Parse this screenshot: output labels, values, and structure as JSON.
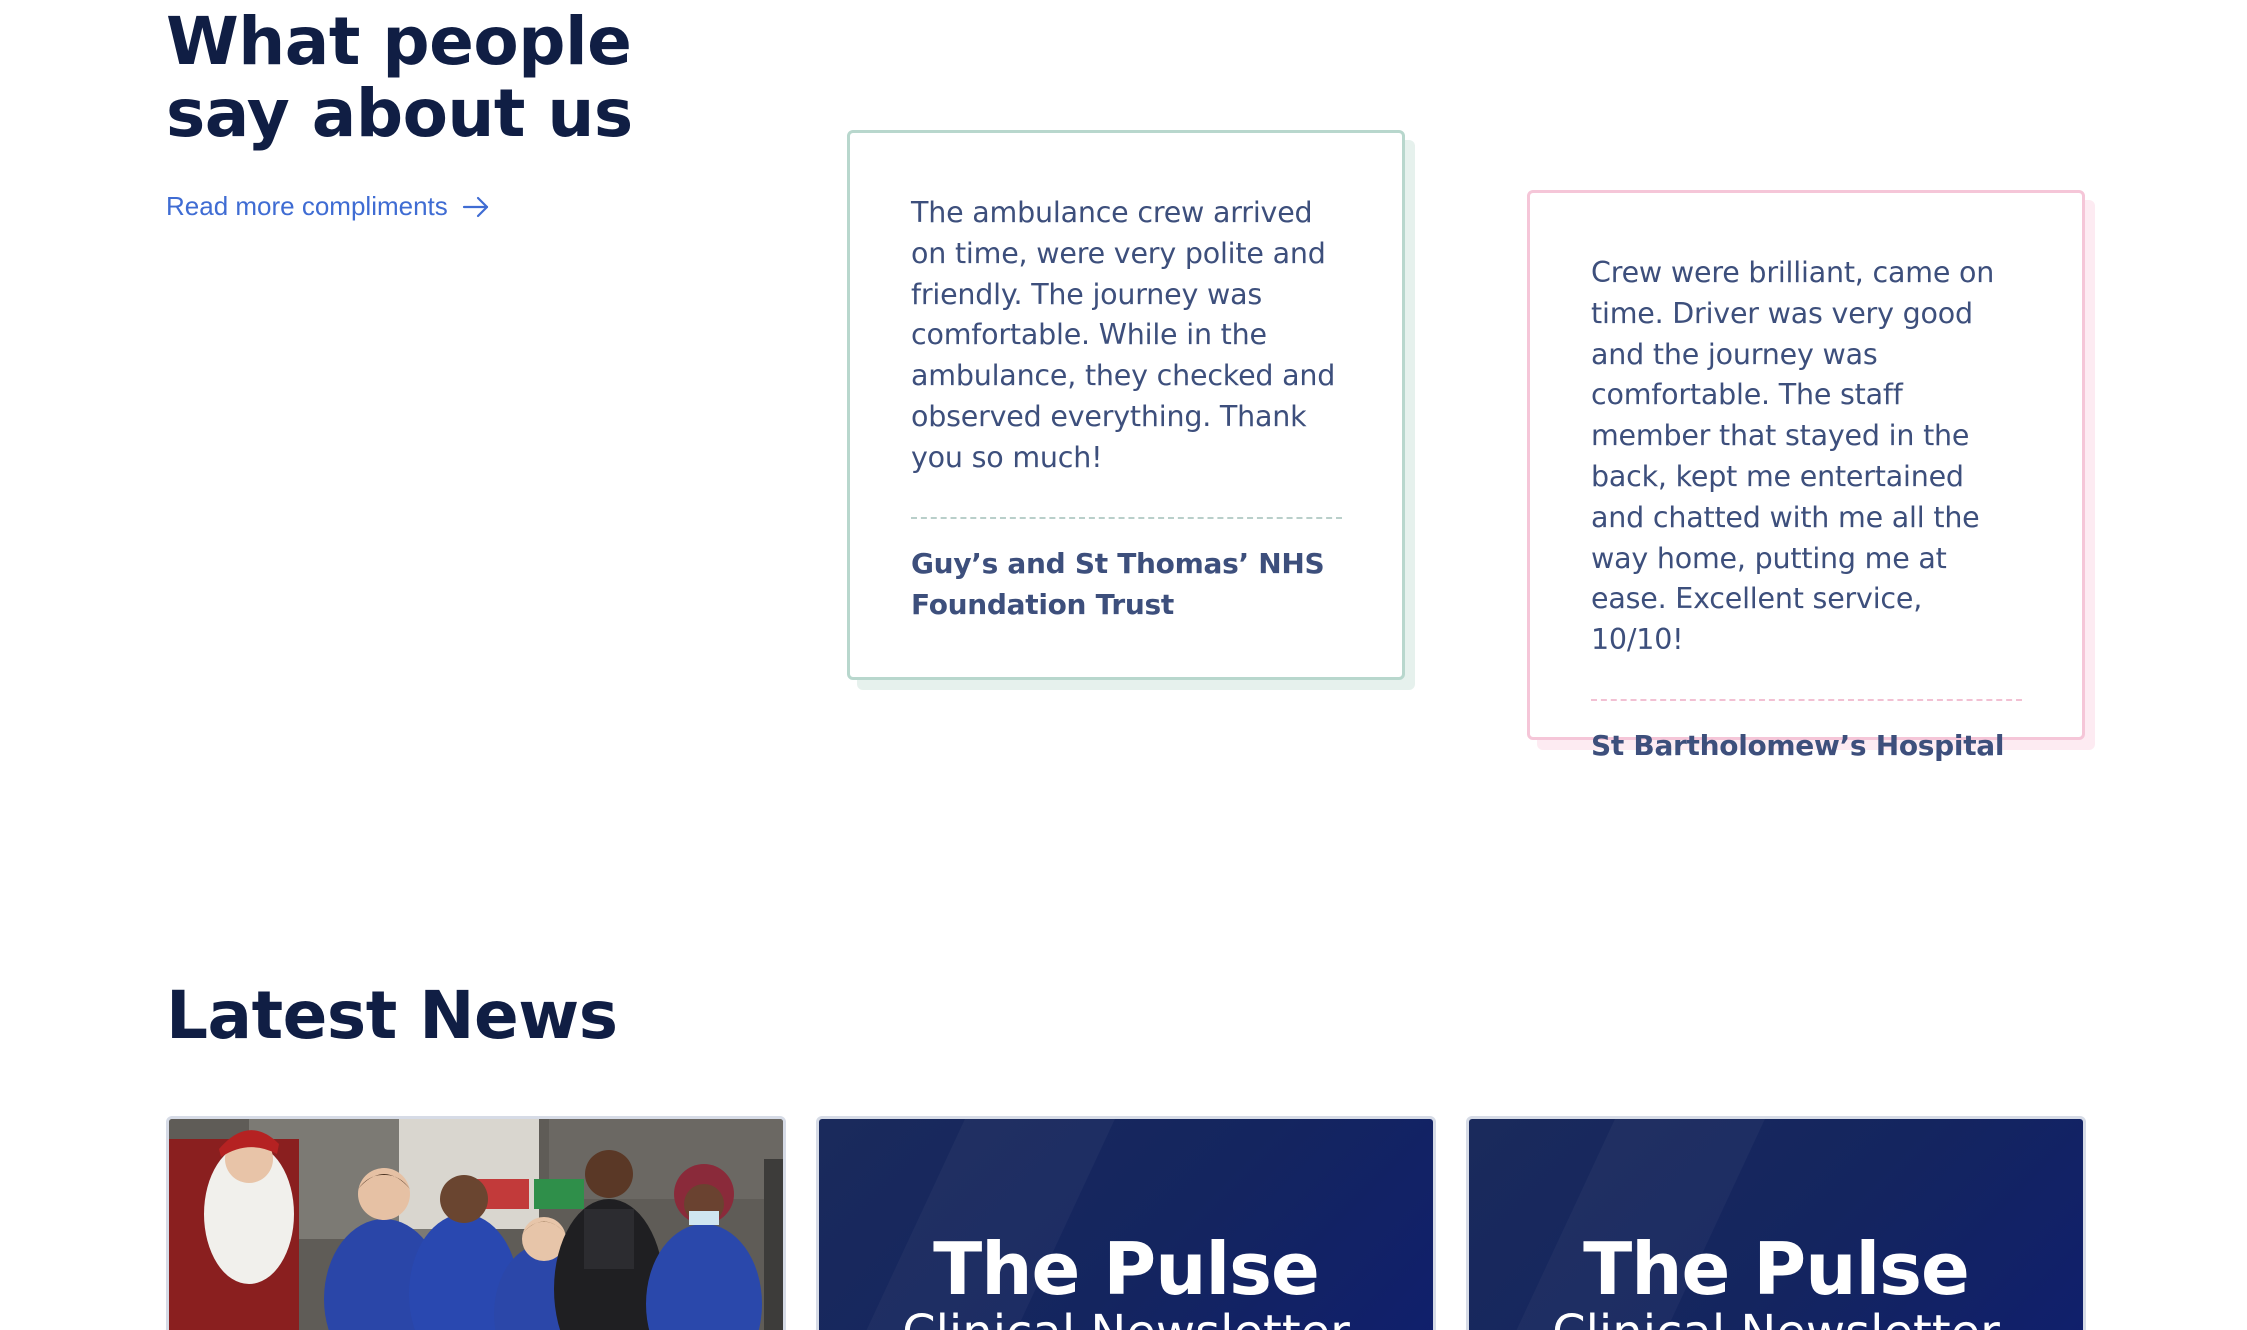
{
  "testimonials": {
    "heading": "What people say about us",
    "read_more_label": "Read more compliments",
    "cards": [
      {
        "quote": "The ambulance crew arrived on time, were very polite and friendly. The journey was comfortable. While in the ambulance, they checked and observed everything. Thank you so much!",
        "source": "Guy’s and St Thomas’ NHS Foundation Trust",
        "accent": "#b8d7cd"
      },
      {
        "quote": "Crew were brilliant, came on time. Driver was very good and the journey was comfortable. The staff member that stayed in the back, kept me entertained and chatted with me all the way home, putting me at ease. Excellent service, 10/10!",
        "source": "St Bartholomew’s Hospital",
        "accent": "#f5c6d8"
      }
    ]
  },
  "news": {
    "heading": "Latest News",
    "cards": [
      {
        "type": "photo",
        "image": "staff-christmas-photo"
      },
      {
        "type": "newsletter",
        "title": "The Pulse",
        "subtitle": "Clinical Newsletter"
      },
      {
        "type": "newsletter",
        "title": "The Pulse",
        "subtitle": "Clinical Newsletter"
      }
    ]
  },
  "colors": {
    "heading": "#101e44",
    "body_text": "#3d4f7c",
    "link": "#3f6cd3",
    "newsletter_bg": "#14255f"
  }
}
